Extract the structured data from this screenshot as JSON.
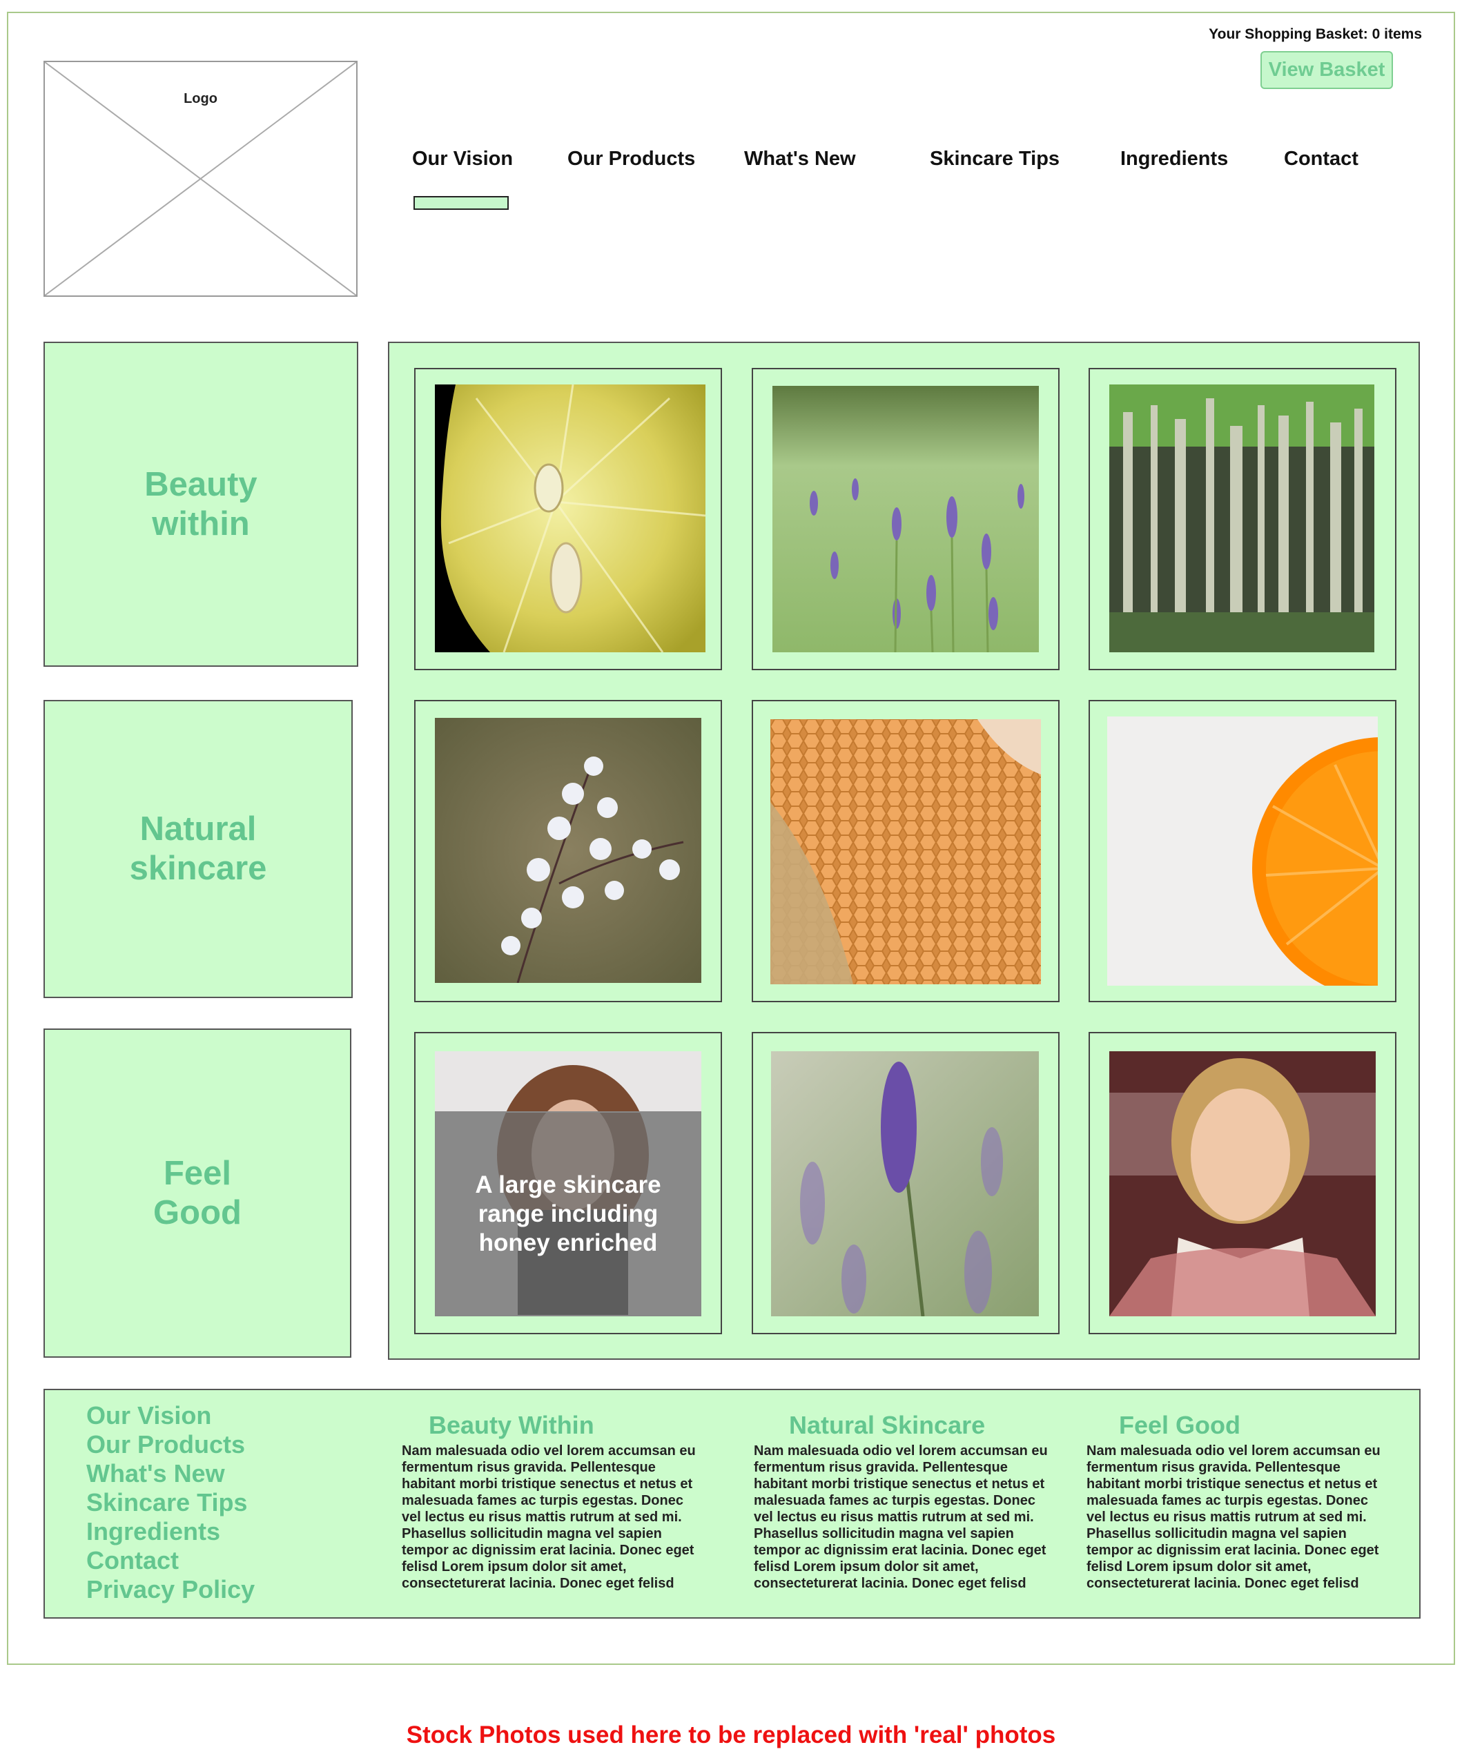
{
  "header": {
    "basket_text": "Your Shopping Basket: 0 items",
    "view_basket_label": "View Basket",
    "logo_label": "Logo"
  },
  "nav": {
    "items": [
      "Our Vision",
      "Our Products",
      "What's New",
      "Skincare Tips",
      "Ingredients",
      "Contact"
    ],
    "active_index": 0
  },
  "sidebar": {
    "boxes": [
      "Beauty\nwithin",
      "Natural\nskincare",
      "Feel\nGood"
    ]
  },
  "gallery": {
    "photos": [
      {
        "subject": "lemon-slice"
      },
      {
        "subject": "lavender-field"
      },
      {
        "subject": "bamboo-forest"
      },
      {
        "subject": "white-blossoms"
      },
      {
        "subject": "honeycomb"
      },
      {
        "subject": "orange-slice"
      },
      {
        "subject": "woman-portrait"
      },
      {
        "subject": "lavender-closeup"
      },
      {
        "subject": "woman-smiling"
      }
    ],
    "overlay_caption": "A large skincare\nrange including\nhoney enriched"
  },
  "footer": {
    "links": [
      "Our Vision",
      "Our Products",
      "What's New",
      "Skincare Tips",
      "Ingredients",
      "Contact",
      "Privacy Policy"
    ],
    "columns": [
      {
        "heading": "Beauty Within",
        "body": "Nam malesuada odio vel lorem accumsan eu fermentum risus gravida. Pellentesque habitant morbi tristique senectus et netus et malesuada fames ac turpis egestas. Donec vel lectus eu risus mattis rutrum at sed mi. Phasellus sollicitudin magna vel sapien tempor ac dignissim erat lacinia. Donec eget felisd Lorem ipsum dolor sit amet, consecteturerat lacinia. Donec eget felisd"
      },
      {
        "heading": "Natural Skincare",
        "body": "Nam malesuada odio vel lorem accumsan eu fermentum risus gravida. Pellentesque habitant morbi tristique senectus et netus et malesuada fames ac turpis egestas. Donec vel lectus eu risus mattis rutrum at sed mi. Phasellus sollicitudin magna vel sapien tempor ac dignissim erat lacinia. Donec eget felisd Lorem ipsum dolor sit amet, consecteturerat lacinia. Donec eget felisd"
      },
      {
        "heading": "Feel Good",
        "body": "Nam malesuada odio vel lorem accumsan eu fermentum risus gravida. Pellentesque habitant morbi tristique senectus et netus et malesuada fames ac turpis egestas. Donec vel lectus eu risus mattis rutrum at sed mi. Phasellus sollicitudin magna vel sapien tempor ac dignissim erat lacinia. Donec eget felisd Lorem ipsum dolor sit amet, consecteturerat lacinia. Donec eget felisd"
      }
    ]
  },
  "disclaimer": "Stock Photos used here to be replaced with 'real' photos",
  "colors": {
    "panel_green": "#ccfccc",
    "accent_green": "#63c68f",
    "warning_red": "#ee1111"
  }
}
